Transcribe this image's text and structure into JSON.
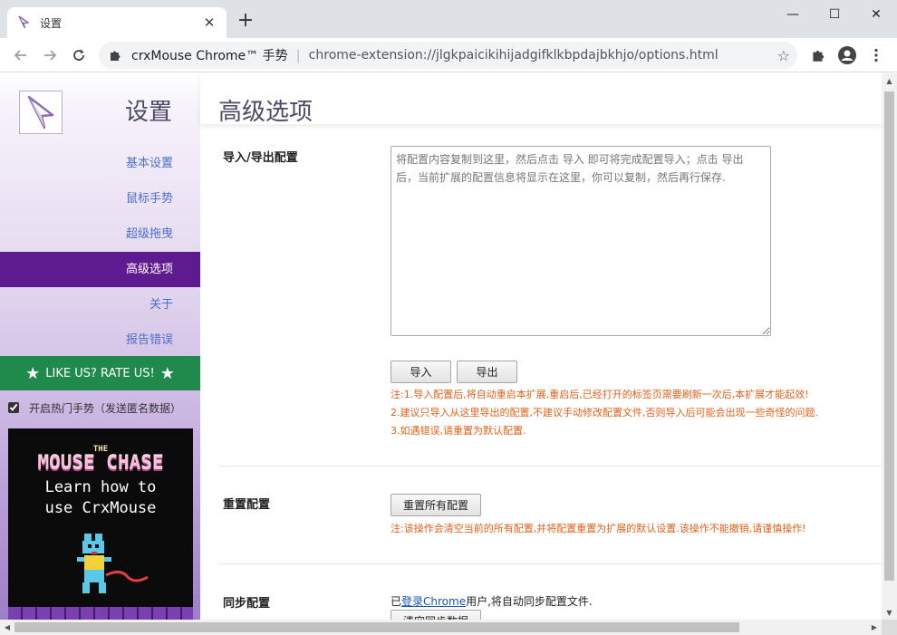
{
  "browser": {
    "tab_title": "设置",
    "close_glyph": "✕",
    "new_tab_glyph": "+",
    "omnibox": {
      "site_name": "crxMouse Chrome™ 手势",
      "separator": "|",
      "url": "chrome-extension://jlgkpaicikihijadgifklkbpdajbkhjo/options.html"
    },
    "window_controls": [
      "—",
      "☐",
      "✕"
    ]
  },
  "sidebar": {
    "title": "设置",
    "nav": [
      "基本设置",
      "鼠标手势",
      "超级拖曳",
      "高级选项",
      "关于",
      "报告错误"
    ],
    "active_index": 3,
    "rate_label": "LIKE US? RATE US!",
    "rate_star": "★",
    "hot_gestures_label": "开启热门手势（发送匿名数据）",
    "hot_gestures_checked": true,
    "promo": {
      "small_title": "THE",
      "big_title": "MOUSE CHASE",
      "line1": "Learn how to",
      "line2": "use CrxMouse"
    }
  },
  "main": {
    "title": "高级选项",
    "import_export": {
      "label": "导入/导出配置",
      "placeholder": "将配置内容复制到这里，然后点击 导入 即可将完成配置导入；点击 导出 后，当前扩展的配置信息将显示在这里，你可以复制，然后再行保存.",
      "import_button": "导入",
      "export_button": "导出",
      "notes": [
        "注:1.导入配置后,将自动重启本扩展,重启后,已经打开的标签页需要刷新一次后,本扩展才能起效!",
        "2.建议只导入从这里导出的配置,不建议手动修改配置文件,否则导入后可能会出现一些奇怪的问题.",
        "3.如遇错误,请重置为默认配置."
      ]
    },
    "reset": {
      "label": "重置配置",
      "button": "重置所有配置",
      "note": "注:该操作会清空当前的所有配置,并将配置重置为扩展的默认设置.该操作不能撤销,请谨慎操作!"
    },
    "sync": {
      "label": "同步配置",
      "text_before": "已",
      "link": "登录Chrome",
      "text_after": "用户,将自动同步配置文件.",
      "button": "清空同步数据"
    }
  },
  "colors": {
    "accent_purple": "#5e1b8f",
    "nav_link": "#4e6ec9",
    "rate_green": "#1f8a4c",
    "note_orange": "#e0621b"
  }
}
